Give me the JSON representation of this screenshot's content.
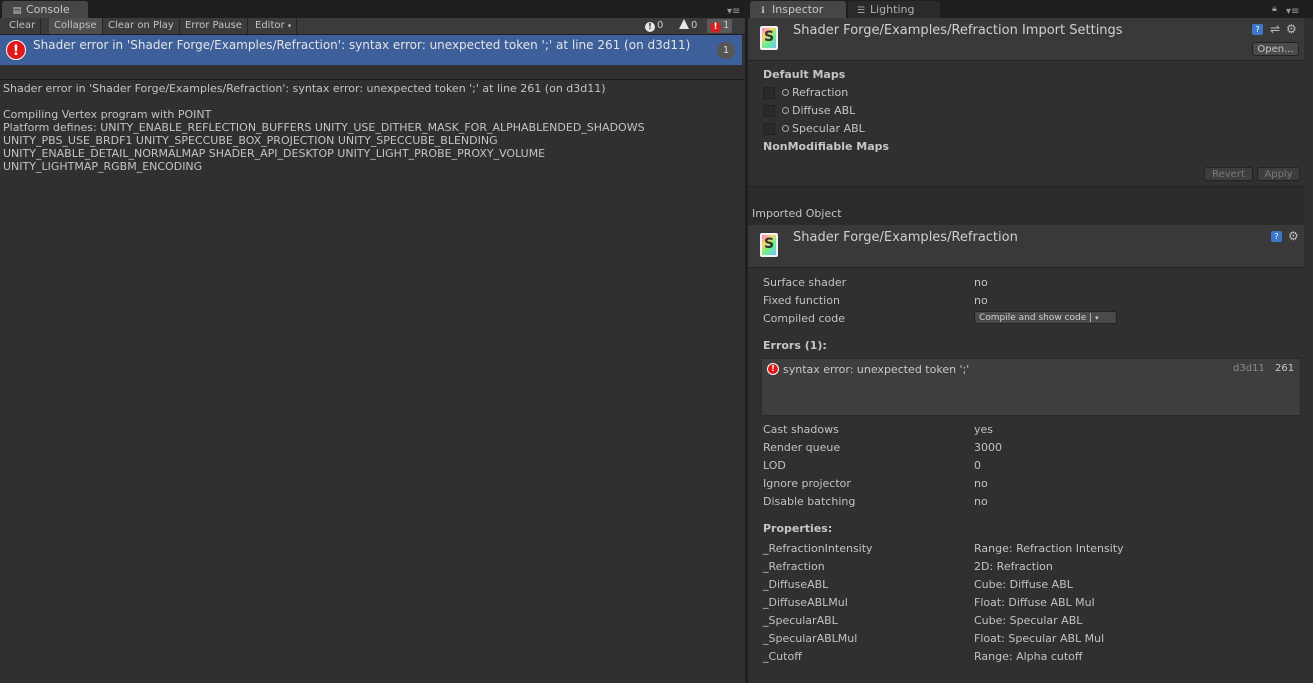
{
  "console": {
    "tab_label": "Console",
    "toolbar": {
      "clear": "Clear",
      "collapse": "Collapse",
      "clear_on_play": "Clear on Play",
      "error_pause": "Error Pause",
      "editor": "Editor",
      "info_count": "0",
      "warning_count": "0",
      "error_count": "1"
    },
    "log_entry": {
      "text": "Shader error in 'Shader Forge/Examples/Refraction': syntax error: unexpected token ';' at line 261 (on d3d11)",
      "count": "1"
    },
    "detail_lines": [
      "Shader error in 'Shader Forge/Examples/Refraction': syntax error: unexpected token ';' at line 261 (on d3d11)",
      "",
      "Compiling Vertex program with POINT",
      "Platform defines: UNITY_ENABLE_REFLECTION_BUFFERS UNITY_USE_DITHER_MASK_FOR_ALPHABLENDED_SHADOWS",
      "UNITY_PBS_USE_BRDF1 UNITY_SPECCUBE_BOX_PROJECTION UNITY_SPECCUBE_BLENDING",
      "UNITY_ENABLE_DETAIL_NORMALMAP SHADER_API_DESKTOP UNITY_LIGHT_PROBE_PROXY_VOLUME",
      "UNITY_LIGHTMAP_RGBM_ENCODING"
    ]
  },
  "inspector": {
    "tabs": {
      "inspector": "Inspector",
      "lighting": "Lighting"
    },
    "import_settings": {
      "title": "Shader Forge/Examples/Refraction Import Settings",
      "open_button": "Open...",
      "default_maps_heading": "Default Maps",
      "maps": [
        "Refraction",
        "Diffuse ABL",
        "Specular ABL"
      ],
      "nonmodifiable_heading": "NonModifiable Maps",
      "revert": "Revert",
      "apply": "Apply"
    },
    "imported_object_label": "Imported Object",
    "shader": {
      "title": "Shader Forge/Examples/Refraction",
      "props_top": [
        {
          "key": "Surface shader",
          "value": "no"
        },
        {
          "key": "Fixed function",
          "value": "no"
        },
        {
          "key": "Compiled code",
          "value": "Compile and show code |"
        }
      ],
      "errors_heading": "Errors (1):",
      "error": {
        "message": "syntax error: unexpected token ';'",
        "platform": "d3d11",
        "line": "261"
      },
      "props_mid": [
        {
          "key": "Cast shadows",
          "value": "yes"
        },
        {
          "key": "Render queue",
          "value": "3000"
        },
        {
          "key": "LOD",
          "value": "0"
        },
        {
          "key": "Ignore projector",
          "value": "no"
        },
        {
          "key": "Disable batching",
          "value": "no"
        }
      ],
      "properties_heading": "Properties:",
      "properties": [
        {
          "key": "_RefractionIntensity",
          "value": "Range: Refraction Intensity"
        },
        {
          "key": "_Refraction",
          "value": "2D: Refraction"
        },
        {
          "key": "_DiffuseABL",
          "value": "Cube: Diffuse ABL"
        },
        {
          "key": "_DiffuseABLMul",
          "value": "Float: Diffuse ABL Mul"
        },
        {
          "key": "_SpecularABL",
          "value": "Cube: Specular ABL"
        },
        {
          "key": "_SpecularABLMul",
          "value": "Float: Specular ABL Mul"
        },
        {
          "key": "_Cutoff",
          "value": "Range: Alpha cutoff"
        }
      ]
    }
  }
}
